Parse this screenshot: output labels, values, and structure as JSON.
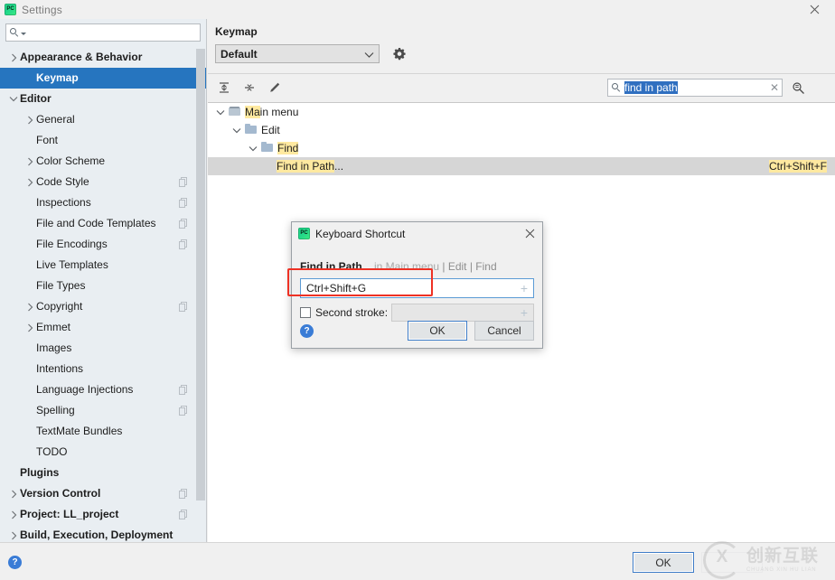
{
  "window": {
    "title": "Settings",
    "app_icon": "pycharm-icon",
    "close_icon": "close-icon"
  },
  "sidebar": {
    "search": {
      "value": "",
      "placeholder": "",
      "icon": "search-icon"
    },
    "items": [
      {
        "label": "Appearance & Behavior",
        "level": 1,
        "arrow": "chevron-right",
        "bold": true,
        "selected": false,
        "badge": false
      },
      {
        "label": "Keymap",
        "level": 2,
        "arrow": "none",
        "bold": true,
        "selected": true,
        "badge": false
      },
      {
        "label": "Editor",
        "level": 1,
        "arrow": "chevron-down",
        "bold": true,
        "selected": false,
        "badge": false
      },
      {
        "label": "General",
        "level": 2,
        "arrow": "chevron-right",
        "bold": false,
        "selected": false,
        "badge": false
      },
      {
        "label": "Font",
        "level": 2,
        "arrow": "none",
        "bold": false,
        "selected": false,
        "badge": false
      },
      {
        "label": "Color Scheme",
        "level": 2,
        "arrow": "chevron-right",
        "bold": false,
        "selected": false,
        "badge": false
      },
      {
        "label": "Code Style",
        "level": 2,
        "arrow": "chevron-right",
        "bold": false,
        "selected": false,
        "badge": true
      },
      {
        "label": "Inspections",
        "level": 2,
        "arrow": "none",
        "bold": false,
        "selected": false,
        "badge": true
      },
      {
        "label": "File and Code Templates",
        "level": 2,
        "arrow": "none",
        "bold": false,
        "selected": false,
        "badge": true
      },
      {
        "label": "File Encodings",
        "level": 2,
        "arrow": "none",
        "bold": false,
        "selected": false,
        "badge": true
      },
      {
        "label": "Live Templates",
        "level": 2,
        "arrow": "none",
        "bold": false,
        "selected": false,
        "badge": false
      },
      {
        "label": "File Types",
        "level": 2,
        "arrow": "none",
        "bold": false,
        "selected": false,
        "badge": false
      },
      {
        "label": "Copyright",
        "level": 2,
        "arrow": "chevron-right",
        "bold": false,
        "selected": false,
        "badge": true
      },
      {
        "label": "Emmet",
        "level": 2,
        "arrow": "chevron-right",
        "bold": false,
        "selected": false,
        "badge": false
      },
      {
        "label": "Images",
        "level": 2,
        "arrow": "none",
        "bold": false,
        "selected": false,
        "badge": false
      },
      {
        "label": "Intentions",
        "level": 2,
        "arrow": "none",
        "bold": false,
        "selected": false,
        "badge": false
      },
      {
        "label": "Language Injections",
        "level": 2,
        "arrow": "none",
        "bold": false,
        "selected": false,
        "badge": true
      },
      {
        "label": "Spelling",
        "level": 2,
        "arrow": "none",
        "bold": false,
        "selected": false,
        "badge": true
      },
      {
        "label": "TextMate Bundles",
        "level": 2,
        "arrow": "none",
        "bold": false,
        "selected": false,
        "badge": false
      },
      {
        "label": "TODO",
        "level": 2,
        "arrow": "none",
        "bold": false,
        "selected": false,
        "badge": false
      },
      {
        "label": "Plugins",
        "level": 1,
        "arrow": "none",
        "bold": true,
        "selected": false,
        "badge": false
      },
      {
        "label": "Version Control",
        "level": 1,
        "arrow": "chevron-right",
        "bold": true,
        "selected": false,
        "badge": true
      },
      {
        "label": "Project: LL_project",
        "level": 1,
        "arrow": "chevron-right",
        "bold": true,
        "selected": false,
        "badge": true
      },
      {
        "label": "Build, Execution, Deployment",
        "level": 1,
        "arrow": "chevron-right",
        "bold": true,
        "selected": false,
        "badge": false
      }
    ]
  },
  "main": {
    "page_title": "Keymap",
    "keymap_select": {
      "value": "Default",
      "chevron": "chevron-down-icon"
    },
    "gear_icon": "gear-icon",
    "toolbar": [
      {
        "icon": "expand-all-icon"
      },
      {
        "icon": "collapse-all-icon"
      },
      {
        "icon": "edit-pencil-icon"
      }
    ],
    "find": {
      "icon": "search-icon",
      "value": "find in path",
      "selected": true,
      "clear_icon": "clear-icon",
      "filter_icon": "find-by-shortcut-icon"
    },
    "tree": [
      {
        "label": "Main menu",
        "indent": 0,
        "twisty": "chevron-down",
        "folder": "menu-folder-icon",
        "highlight": "Ma",
        "shortcut": ""
      },
      {
        "label": "Edit",
        "indent": 1,
        "twisty": "chevron-down",
        "folder": "folder-icon",
        "highlight": "",
        "shortcut": ""
      },
      {
        "label": "Find",
        "indent": 2,
        "twisty": "chevron-down",
        "folder": "folder-icon",
        "highlight": "Find",
        "shortcut": ""
      },
      {
        "label": "Find in Path...",
        "indent": 3,
        "twisty": "none",
        "folder": "none",
        "highlight": "Find in Path",
        "shortcut": "Ctrl+Shift+F",
        "selected": true
      }
    ]
  },
  "dialog": {
    "title": "Keyboard Shortcut",
    "icon": "pycharm-icon",
    "close_icon": "close-icon",
    "action_name": "Find in Path...",
    "action_context_in": " in Main menu",
    "action_context_rest": " | Edit | Find",
    "first_stroke": {
      "value": "Ctrl+Shift+G",
      "plus_icon": "plus-icon"
    },
    "second_stroke": {
      "label": "Second stroke:",
      "checked": false,
      "value": "",
      "plus_icon": "plus-icon"
    },
    "help_icon": "help-icon",
    "ok_label": "OK",
    "cancel_label": "Cancel"
  },
  "footer": {
    "help_icon": "help-icon",
    "ok_label": "OK"
  },
  "watermark": {
    "cn": "创新互联",
    "en": "CHUANG XIN HU LIAN"
  },
  "colors": {
    "selection_blue": "#2675bf",
    "highlight_yellow": "#ffe9a0",
    "focus_blue": "#5b9bd5",
    "annotation_red": "#ee3124"
  }
}
